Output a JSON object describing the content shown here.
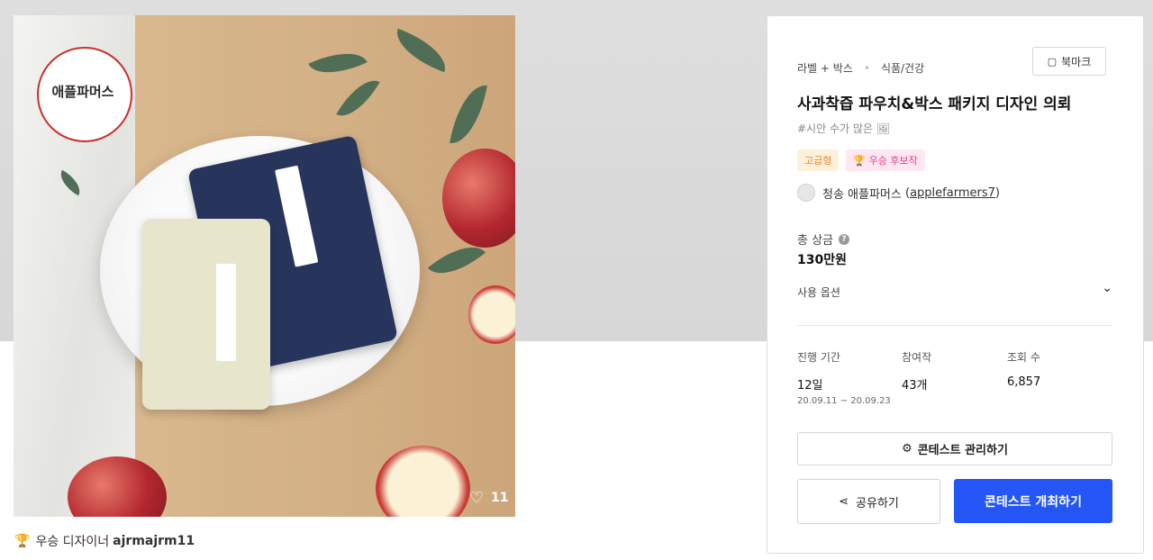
{
  "image": {
    "logo_text": "애플파머스",
    "like_count": "11"
  },
  "winner": {
    "label": "우승 디자이너",
    "name": "ajrmajrm11"
  },
  "panel": {
    "category": "라벨 + 박스",
    "subcategory": "식품/건강",
    "bookmark_label": "북마크",
    "title": "사과착즙 파우치&박스 패키지 디자인 의뢰",
    "hashtag": "#시안 수가 많은 🖼",
    "badges": {
      "premium": "고급형",
      "candidate": "🏆 우승 후보작"
    },
    "host": {
      "name": "청송 애플파머스",
      "id": "applefarmers7"
    },
    "prize": {
      "label": "총 상금",
      "value": "130만원"
    },
    "usage_label": "사용 옵션",
    "stats": {
      "duration": {
        "label": "진행 기간",
        "value": "12일",
        "range": "20.09.11 ~ 20.09.23"
      },
      "entries": {
        "label": "참여작",
        "value": "43개"
      },
      "views": {
        "label": "조회 수",
        "value": "6,857"
      }
    },
    "manage_label": "콘테스트 관리하기",
    "share_label": "공유하기",
    "host_contest_label": "콘테스트 개최하기"
  },
  "colors": {
    "primary": "#2456f5",
    "premium_badge": "#e08b2d",
    "candidate_badge": "#d84583"
  },
  "icons": [
    "heart-icon",
    "trophy-icon",
    "bookmark-icon",
    "help-icon",
    "chevron-down-icon",
    "gear-icon",
    "share-icon"
  ]
}
